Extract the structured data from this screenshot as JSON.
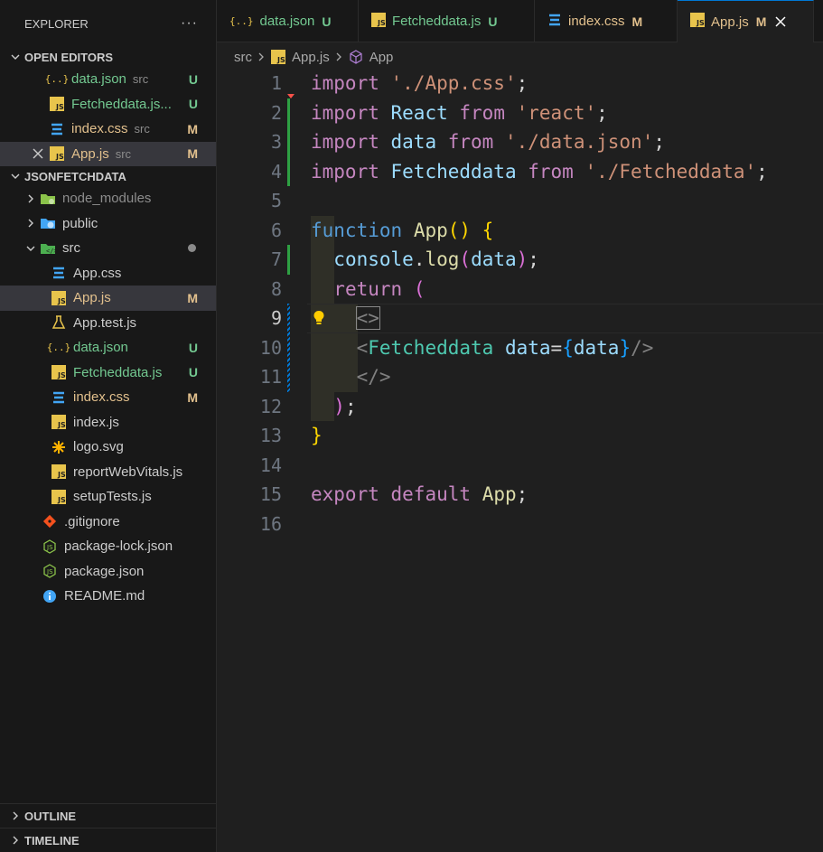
{
  "explorer": {
    "title": "EXPLORER",
    "more": "···",
    "open_editors": {
      "title": "OPEN EDITORS",
      "items": [
        {
          "name": "data.json",
          "desc": "src",
          "badge": "U",
          "icon": "json-icon"
        },
        {
          "name": "Fetcheddata.js...",
          "desc": "",
          "badge": "U",
          "icon": "js-icon"
        },
        {
          "name": "index.css",
          "desc": "src",
          "badge": "M",
          "icon": "css-icon"
        },
        {
          "name": "App.js",
          "desc": "src",
          "badge": "M",
          "icon": "js-icon"
        }
      ]
    },
    "project": {
      "title": "JSONFETCHDATA",
      "items": [
        {
          "name": "node_modules",
          "icon": "node-folder-icon"
        },
        {
          "name": "public",
          "icon": "public-folder-icon"
        },
        {
          "name": "src",
          "icon": "src-folder-icon"
        },
        {
          "name": "App.css",
          "icon": "css-icon"
        },
        {
          "name": "App.js",
          "badge": "M",
          "icon": "js-icon"
        },
        {
          "name": "App.test.js",
          "icon": "test-icon"
        },
        {
          "name": "data.json",
          "badge": "U",
          "icon": "json-icon"
        },
        {
          "name": "Fetcheddata.js",
          "badge": "U",
          "icon": "js-icon"
        },
        {
          "name": "index.css",
          "badge": "M",
          "icon": "css-icon"
        },
        {
          "name": "index.js",
          "icon": "js-icon"
        },
        {
          "name": "logo.svg",
          "icon": "svg-icon"
        },
        {
          "name": "reportWebVitals.js",
          "icon": "js-icon"
        },
        {
          "name": "setupTests.js",
          "icon": "js-icon"
        },
        {
          "name": ".gitignore",
          "icon": "git-icon"
        },
        {
          "name": "package-lock.json",
          "icon": "node-icon"
        },
        {
          "name": "package.json",
          "icon": "node-icon"
        },
        {
          "name": "README.md",
          "icon": "info-icon"
        }
      ]
    },
    "outline": "OUTLINE",
    "timeline": "TIMELINE"
  },
  "tabs": [
    {
      "name": "data.json",
      "badge": "U"
    },
    {
      "name": "Fetcheddata.js",
      "badge": "U"
    },
    {
      "name": "index.css",
      "badge": "M"
    },
    {
      "name": "App.js",
      "badge": "M"
    }
  ],
  "breadcrumb": {
    "folder": "src",
    "file": "App.js",
    "symbol": "App"
  },
  "editor": {
    "line_numbers": [
      "1",
      "2",
      "3",
      "4",
      "5",
      "6",
      "7",
      "8",
      "9",
      "10",
      "11",
      "12",
      "13",
      "14",
      "15",
      "16"
    ],
    "tokens": {
      "import": "import",
      "from": "from",
      "app_css": "'./App.css'",
      "react": "React",
      "react_str": "'react'",
      "data": "data",
      "data_json": "'./data.json'",
      "fetched": "Fetcheddata",
      "fetched_str": "'./Fetcheddata'",
      "semi": ";",
      "function": "function",
      "app": "App",
      "console": "console",
      "log": "log",
      "return": "return",
      "export": "export",
      "default": "default",
      "frag_open": "<>",
      "frag_close": "</>"
    }
  },
  "colors": {
    "accent": "#0078d4",
    "untracked": "#73c991",
    "modified": "#e2c08d"
  }
}
